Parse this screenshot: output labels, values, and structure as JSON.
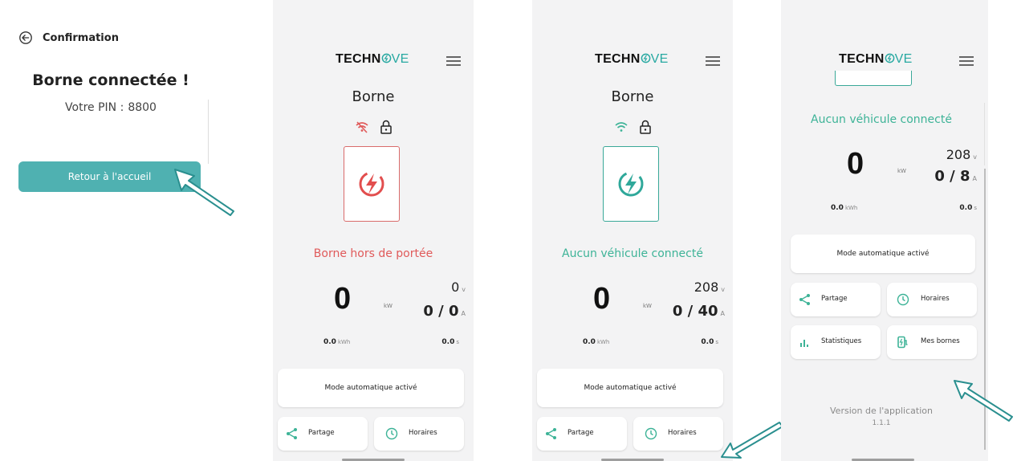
{
  "screens": {
    "s1": {
      "header_title": "Confirmation",
      "heading": "Borne connectée !",
      "pin_label": "Votre PIN :",
      "pin_value": "8800",
      "button_label": "Retour à l'accueil"
    },
    "s2": {
      "title": "Borne",
      "status": "Borne hors de portée",
      "power_value": "0",
      "power_unit": "kW",
      "voltage_value": "0",
      "voltage_unit": "v",
      "current_value": "0 / 0",
      "current_unit": "A",
      "energy_value": "0.0",
      "energy_unit": "kWh",
      "duration_value": "0.0",
      "duration_unit": "s",
      "mode_label": "Mode automatique activé",
      "share_label": "Partage",
      "schedule_label": "Horaires"
    },
    "s3": {
      "title": "Borne",
      "status": "Aucun véhicule connecté",
      "power_value": "0",
      "power_unit": "kW",
      "voltage_value": "208",
      "voltage_unit": "v",
      "current_value": "0 / 40",
      "current_unit": "A",
      "energy_value": "0.0",
      "energy_unit": "kWh",
      "duration_value": "0.0",
      "duration_unit": "s",
      "mode_label": "Mode automatique activé",
      "share_label": "Partage",
      "schedule_label": "Horaires"
    },
    "s4": {
      "status": "Aucun véhicule connecté",
      "power_value": "0",
      "power_unit": "kW",
      "voltage_value": "208",
      "voltage_unit": "v",
      "current_value": "0 / 8",
      "current_unit": "A",
      "energy_value": "0.0",
      "energy_unit": "kWh",
      "duration_value": "0.0",
      "duration_unit": "s",
      "mode_label": "Mode automatique activé",
      "share_label": "Partage",
      "schedule_label": "Horaires",
      "stats_label": "Statistiques",
      "chargers_label": "Mes bornes",
      "version_label": "Version de l'application",
      "version_number": "1.1.1"
    }
  },
  "brand": {
    "logo_dark": "TECHN",
    "logo_teal": "VE"
  },
  "colors": {
    "teal": "#3db397",
    "button_teal": "#4fb1b1",
    "error_red": "#e05a5a",
    "arrow_teal": "#2a8f8f"
  },
  "icons": [
    "back-arrow-icon",
    "wifi-off-icon",
    "wifi-icon",
    "lock-icon",
    "lightning-bolt-icon",
    "share-icon",
    "clock-icon",
    "stats-icon",
    "charger-icon",
    "hamburger-menu-icon",
    "pointer-arrow-icon"
  ]
}
